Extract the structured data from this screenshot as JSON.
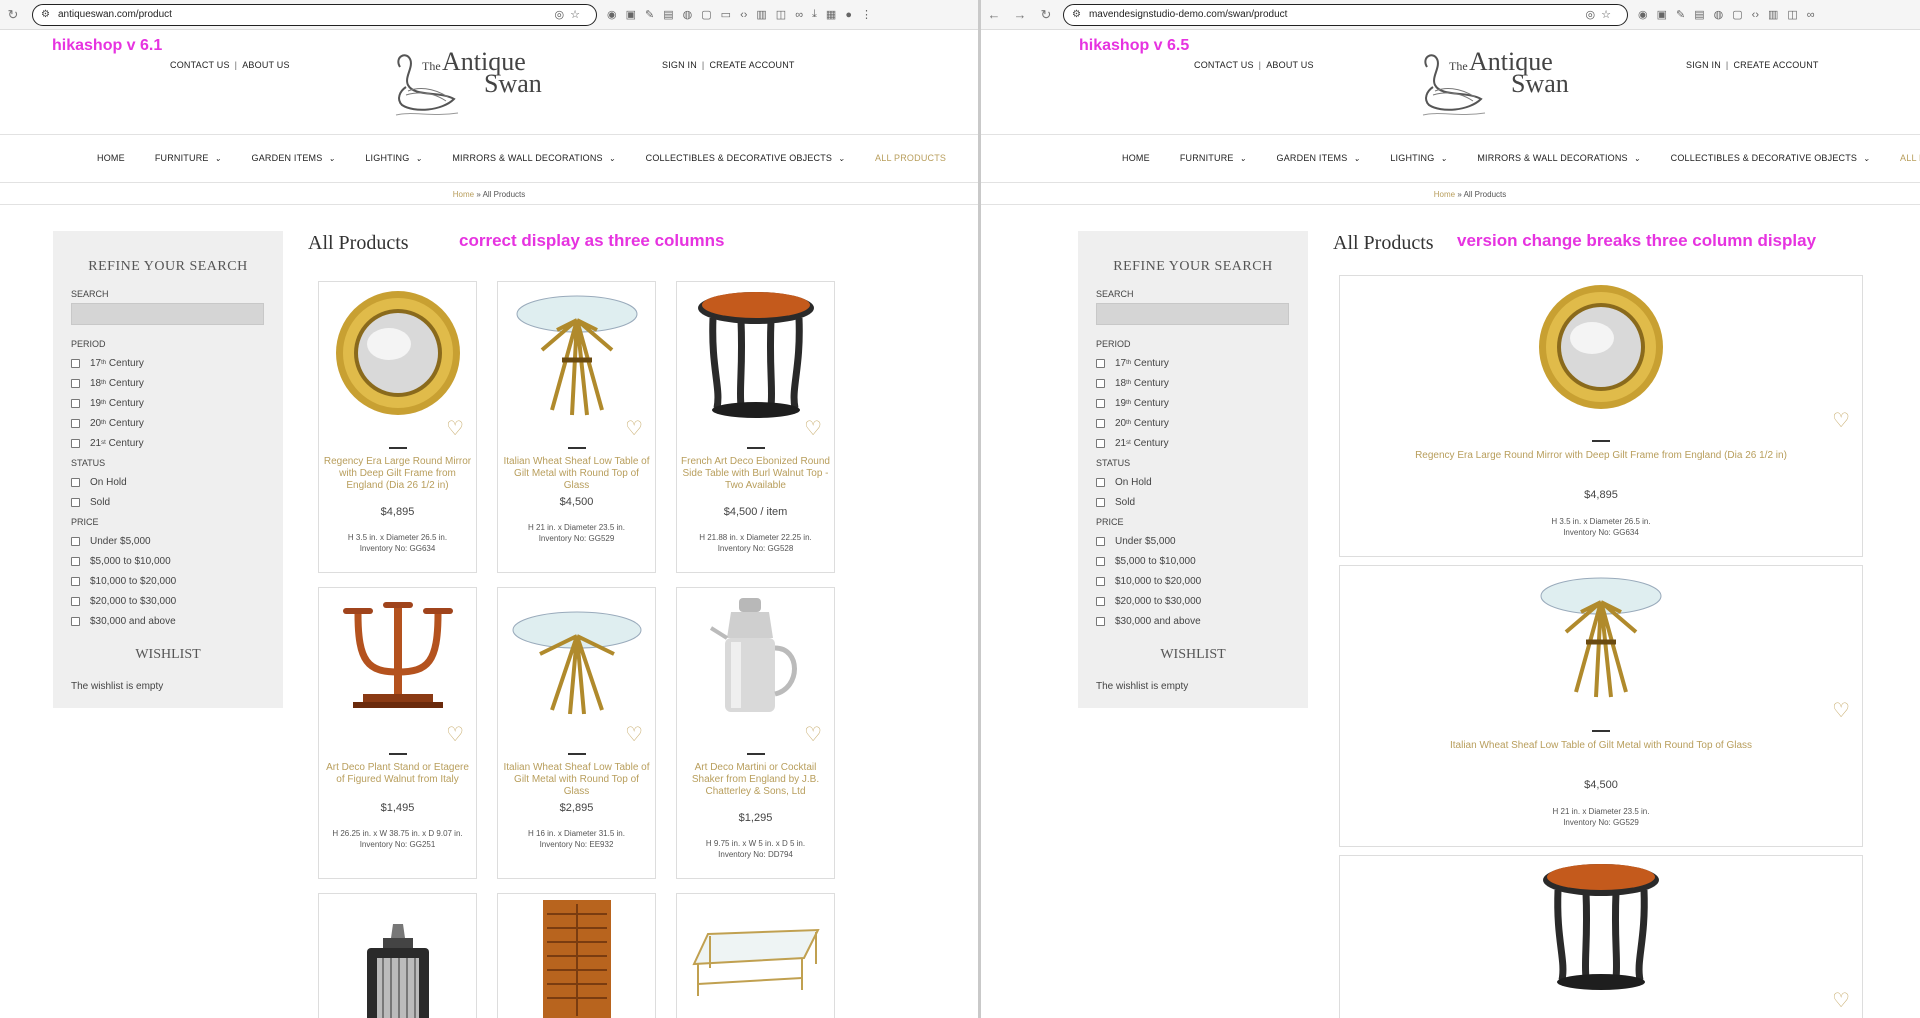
{
  "left": {
    "url": "antiqueswan.com/product",
    "version": "hikashop v 6.1",
    "note": "correct display as three columns"
  },
  "right": {
    "url": "mavendesignstudio-demo.com/swan/product",
    "version": "hikashop v 6.5",
    "note": "version change breaks three column display"
  },
  "header": {
    "contact": "CONTACT US",
    "about": "ABOUT US",
    "sign_in": "SIGN IN",
    "create_account": "CREATE ACCOUNT",
    "logo_the": "The",
    "logo_antique": "Antique",
    "logo_swan": "Swan"
  },
  "nav": {
    "home": "HOME",
    "furniture": "FURNITURE",
    "garden": "GARDEN ITEMS",
    "lighting": "LIGHTING",
    "mirrors": "MIRRORS & WALL DECORATIONS",
    "collectibles": "COLLECTIBLES & DECORATIVE OBJECTS",
    "all": "ALL PRODUCTS"
  },
  "breadcrumb": {
    "home": "Home",
    "sep": "»",
    "current": "All Products"
  },
  "page_title": "All Products",
  "sidebar": {
    "title": "REFINE YOUR SEARCH",
    "search_label": "SEARCH",
    "period_label": "PERIOD",
    "periods": [
      {
        "num": "17",
        "sup": "th",
        "word": "Century"
      },
      {
        "num": "18",
        "sup": "th",
        "word": "Century"
      },
      {
        "num": "19",
        "sup": "th",
        "word": "Century"
      },
      {
        "num": "20",
        "sup": "th",
        "word": "Century"
      },
      {
        "num": "21",
        "sup": "st",
        "word": "Century"
      }
    ],
    "status_label": "STATUS",
    "statuses": [
      "On Hold",
      "Sold"
    ],
    "price_label": "PRICE",
    "prices": [
      "Under $5,000",
      "$5,000 to $10,000",
      "$10,000 to $20,000",
      "$20,000 to $30,000",
      "$30,000 and above"
    ],
    "wishlist_title": "WISHLIST",
    "wishlist_empty": "The wishlist is empty"
  },
  "products": [
    {
      "name": "Regency Era Large Round Mirror with Deep Gilt Frame from England (Dia 26 1/2 in)",
      "price": "$4,895",
      "dims": "H 3.5 in. x Diameter 26.5 in.",
      "inv": "Inventory No: GG634"
    },
    {
      "name": "Italian Wheat Sheaf Low Table of Gilt Metal with Round Top of Glass",
      "price": "$4,500",
      "dims": "H 21 in. x Diameter 23.5 in.",
      "inv": "Inventory No: GG529"
    },
    {
      "name": "French Art Deco Ebonized Round Side Table with Burl Walnut Top - Two Available",
      "price": "$4,500 / item",
      "dims": "H 21.88 in. x Diameter 22.25 in.",
      "inv": "Inventory No: GG528"
    },
    {
      "name": "Art Deco Plant Stand or Etagere of Figured Walnut from Italy",
      "price": "$1,495",
      "dims": "H 26.25 in. x W 38.75 in. x D 9.07 in.",
      "inv": "Inventory No: GG251"
    },
    {
      "name": "Italian Wheat Sheaf Low Table of Gilt Metal with Round Top of Glass",
      "price": "$2,895",
      "dims": "H 16 in. x Diameter 31.5 in.",
      "inv": "Inventory No: EE932"
    },
    {
      "name": "Art Deco Martini or Cocktail Shaker from England by J.B. Chatterley & Sons, Ltd",
      "price": "$1,295",
      "dims": "H 9.75 in. x W 5 in. x D 5 in.",
      "inv": "Inventory No: DD794"
    }
  ]
}
